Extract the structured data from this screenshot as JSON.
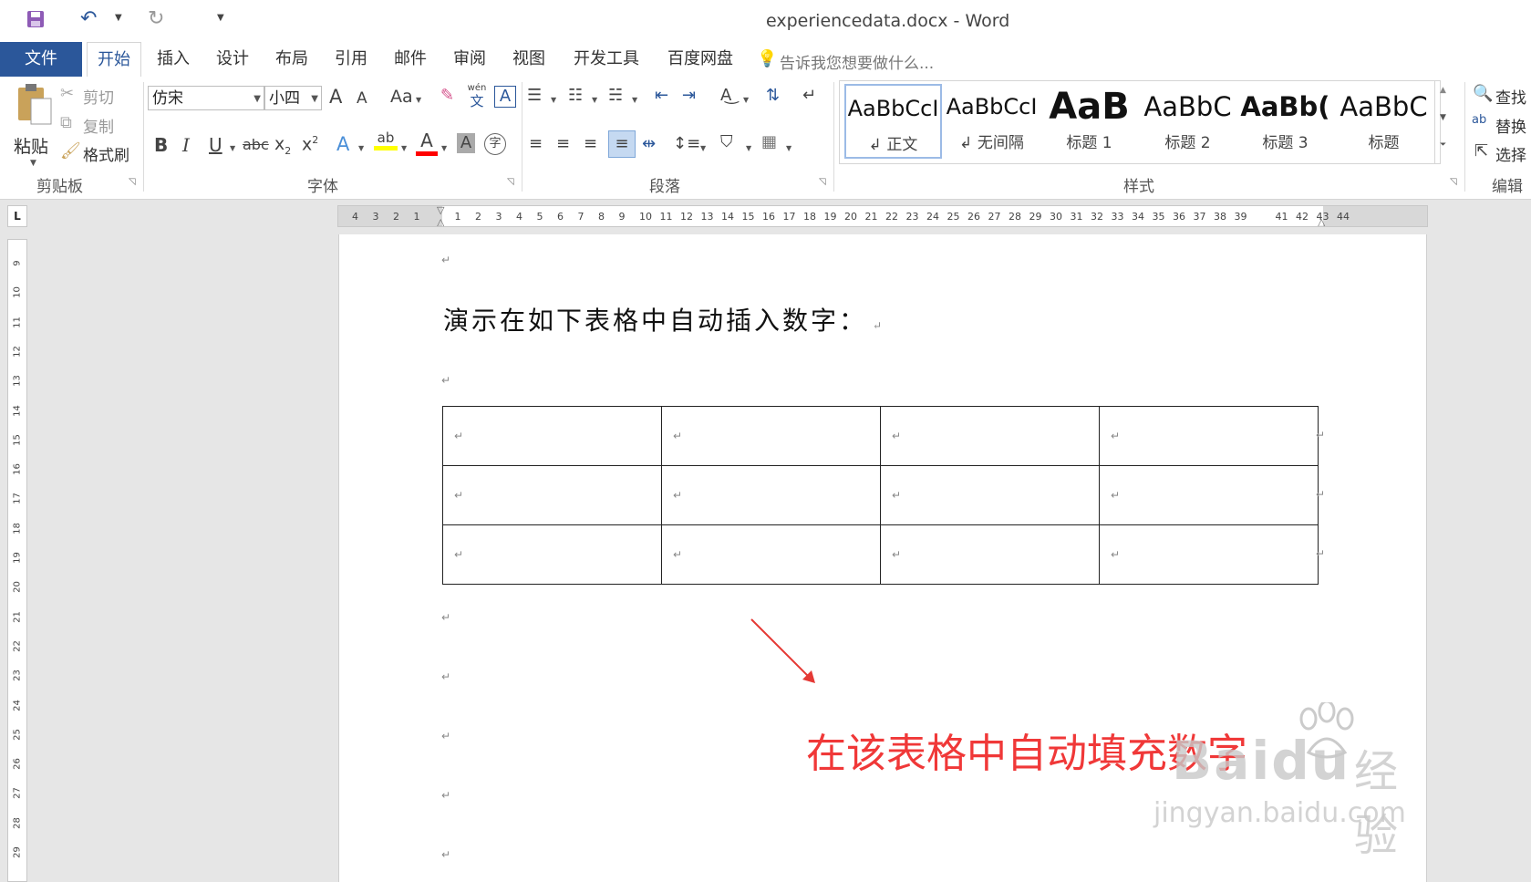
{
  "window": {
    "title": "experiencedata.docx - Word"
  },
  "tabs": [
    {
      "label": "文件"
    },
    {
      "label": "开始"
    },
    {
      "label": "插入"
    },
    {
      "label": "设计"
    },
    {
      "label": "布局"
    },
    {
      "label": "引用"
    },
    {
      "label": "邮件"
    },
    {
      "label": "审阅"
    },
    {
      "label": "视图"
    },
    {
      "label": "开发工具"
    },
    {
      "label": "百度网盘"
    }
  ],
  "tell_me": {
    "placeholder": "告诉我您想要做什么..."
  },
  "clipboard": {
    "paste": "粘贴",
    "cut": "剪切",
    "copy": "复制",
    "format_painter": "格式刷",
    "group": "剪贴板"
  },
  "font": {
    "name": "仿宋",
    "size": "小四",
    "group": "字体",
    "bold": "B",
    "italic": "I",
    "underline": "U",
    "strike": "abc",
    "change_case": "Aa",
    "grow": "A",
    "shrink": "A",
    "phonetic": "wén",
    "phonetic_char": "文",
    "border_char": "A",
    "enclose": "字"
  },
  "paragraph": {
    "group": "段落"
  },
  "styles": {
    "group": "样式",
    "items": [
      {
        "preview": "AaBbCcI",
        "name": "正文"
      },
      {
        "preview": "AaBbCcI",
        "name": "无间隔"
      },
      {
        "preview": "AaB",
        "name": "标题 1"
      },
      {
        "preview": "AaBbC",
        "name": "标题 2"
      },
      {
        "preview": "AaBb(",
        "name": "标题 3"
      },
      {
        "preview": "AaBbC",
        "name": "标题"
      }
    ]
  },
  "editing": {
    "find": "查找",
    "replace": "替换",
    "select": "选择",
    "group": "编辑"
  },
  "ruler": {
    "corner": "L",
    "left_numbers": [
      "4",
      "3",
      "2",
      "1"
    ],
    "right_numbers": [
      "1",
      "2",
      "3",
      "4",
      "5",
      "6",
      "7",
      "8",
      "9",
      "10",
      "11",
      "12",
      "13",
      "14",
      "15",
      "16",
      "17",
      "18",
      "19",
      "20",
      "21",
      "22",
      "23",
      "24",
      "25",
      "26",
      "27",
      "28",
      "29",
      "30",
      "31",
      "32",
      "33",
      "34",
      "35",
      "36",
      "37",
      "38",
      "39"
    ],
    "after_numbers": [
      "41",
      "42",
      "43",
      "44"
    ],
    "vertical_numbers": [
      "9",
      "10",
      "11",
      "12",
      "13",
      "14",
      "15",
      "16",
      "17",
      "18",
      "19",
      "20",
      "21",
      "22",
      "23",
      "24",
      "25",
      "26",
      "27",
      "28",
      "29"
    ]
  },
  "document": {
    "heading": "演示在如下表格中自动插入数字：",
    "para_mark": "↵",
    "table": {
      "rows": 3,
      "cols": 4
    }
  },
  "annotation": {
    "text": "在该表格中自动填充数字",
    "color": "#f03838"
  },
  "watermark": {
    "brand": "Baidu",
    "label": "经验",
    "url": "jingyan.baidu.com"
  },
  "colors": {
    "accent": "#2b579a",
    "highlight_yellow": "#ffff00",
    "font_red": "#ff0000"
  }
}
